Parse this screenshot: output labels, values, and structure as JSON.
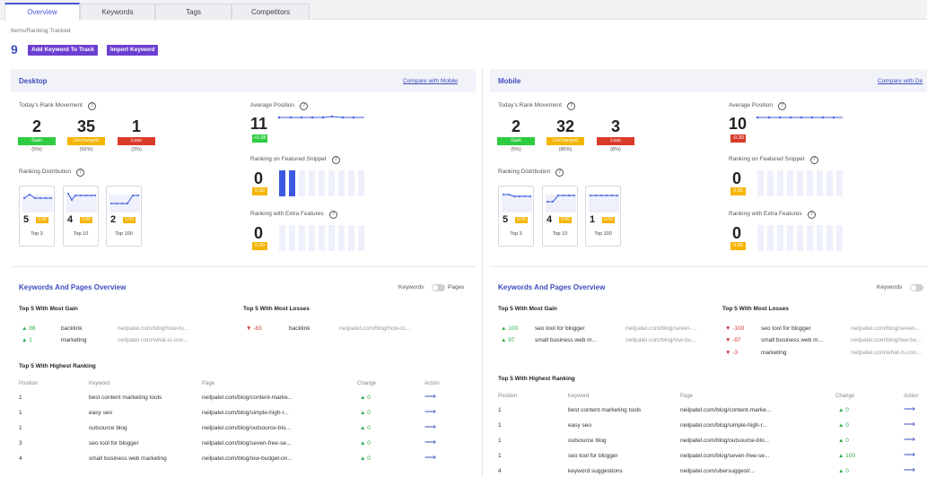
{
  "tabs": [
    "Overview",
    "Keywords",
    "Tags",
    "Competitors"
  ],
  "header": {
    "caption": "Items/Ranking Tracked",
    "count": "9",
    "add_btn": "Add Keyword To Track",
    "import_btn": "Import Keyword"
  },
  "desktop": {
    "title": "Desktop",
    "compare": "Compare with Mobile",
    "rank_movement": "Today's Rank Movement",
    "gain": {
      "value": "2",
      "label": "Gain",
      "pct": "(5%)"
    },
    "unchanged": {
      "value": "35",
      "label": "Unchanged",
      "pct": "(92%)"
    },
    "loss": {
      "value": "1",
      "label": "Loss",
      "pct": "(3%)"
    },
    "dist_label": "Ranking Distribution",
    "cards": [
      {
        "num": "5",
        "chg": "0.00",
        "label": "Top 3"
      },
      {
        "num": "4",
        "chg": "0.00",
        "label": "Top 10"
      },
      {
        "num": "2",
        "chg": "0.00",
        "label": "Top 100"
      }
    ],
    "avg_label": "Average Position",
    "avg_value": "11",
    "avg_change": "+0.38",
    "snippet_label": "Ranking on Featured Snippet",
    "snippet_value": "0",
    "snippet_change": "0.00",
    "extra_label": "Ranking with Extra Features",
    "extra_value": "0",
    "extra_change": "0.00",
    "overview_title": "Keywords And Pages Overview",
    "toggle_left": "Keywords",
    "toggle_right": "Pages",
    "gain_title": "Top 5 With Most Gain",
    "loss_title": "Top 5 With Most Losses",
    "gains": [
      {
        "change": "86",
        "keyword": "backlink",
        "url": "neilpatel.com/blog/how-to..."
      },
      {
        "change": "1",
        "keyword": "marketing",
        "url": "neilpatel.com/what-is-con..."
      }
    ],
    "losses": [
      {
        "change": "-83",
        "keyword": "backlink",
        "url": "neilpatel.com/blog/how-to..."
      }
    ],
    "highest_title": "Top 5 With Highest Ranking",
    "cols": [
      "Position",
      "Keyword",
      "Page",
      "Change",
      "Action"
    ],
    "rows": [
      {
        "pos": "1",
        "kw": "best content marketing tools",
        "page": "neilpatel.com/blog/content-marke...",
        "chg": "0"
      },
      {
        "pos": "1",
        "kw": "easy seo",
        "page": "neilpatel.com/blog/simple-high-r...",
        "chg": "0"
      },
      {
        "pos": "1",
        "kw": "outsource blog",
        "page": "neilpatel.com/blog/outsource-blo...",
        "chg": "0"
      },
      {
        "pos": "3",
        "kw": "seo tool for blogger",
        "page": "neilpatel.com/blog/seven-free-se...",
        "chg": "0"
      },
      {
        "pos": "4",
        "kw": "small business web marketing",
        "page": "neilpatel.com/blog/low-budget-on...",
        "chg": "0"
      }
    ]
  },
  "mobile": {
    "title": "Mobile",
    "compare": "Compare with De",
    "rank_movement": "Today's Rank Movement",
    "gain": {
      "value": "2",
      "label": "Gain",
      "pct": "(5%)"
    },
    "unchanged": {
      "value": "32",
      "label": "Unchanged",
      "pct": "(86%)"
    },
    "loss": {
      "value": "3",
      "label": "Loss",
      "pct": "(8%)"
    },
    "dist_label": "Ranking Distribution",
    "cards": [
      {
        "num": "5",
        "chg": "0.00",
        "label": "Top 3"
      },
      {
        "num": "4",
        "chg": "0.00",
        "label": "Top 10"
      },
      {
        "num": "1",
        "chg": "0.00",
        "label": "Top 100"
      }
    ],
    "avg_label": "Average Position",
    "avg_value": "10",
    "avg_change": "-0.30",
    "snippet_label": "Ranking on Featured Snippet",
    "snippet_value": "0",
    "snippet_change": "0.00",
    "extra_label": "Ranking with Extra Features",
    "extra_value": "0",
    "extra_change": "0.00",
    "overview_title": "Keywords And Pages Overview",
    "toggle_left": "Keywords",
    "gain_title": "Top 5 With Most Gain",
    "loss_title": "Top 5 With Most Losses",
    "gains": [
      {
        "change": "100",
        "keyword": "seo tool for blogger",
        "url": "neilpatel.com/blog/seven-..."
      },
      {
        "change": "97",
        "keyword": "small business web m...",
        "url": "neilpatel.com/blog/low-bu..."
      }
    ],
    "losses": [
      {
        "change": "-100",
        "keyword": "seo tool for blogger",
        "url": "neilpatel.com/blog/seven-..."
      },
      {
        "change": "-97",
        "keyword": "small business web m...",
        "url": "neilpatel.com/blog/low-bu..."
      },
      {
        "change": "-3",
        "keyword": "marketing",
        "url": "neilpatel.com/what-is-con..."
      }
    ],
    "highest_title": "Top 5 With Highest Ranking",
    "cols": [
      "Position",
      "Keyword",
      "Page",
      "Change",
      "Action"
    ],
    "rows": [
      {
        "pos": "1",
        "kw": "best content marketing tools",
        "page": "neilpatel.com/blog/content-marke...",
        "chg": "0"
      },
      {
        "pos": "1",
        "kw": "easy seo",
        "page": "neilpatel.com/blog/simple-high-r...",
        "chg": "0"
      },
      {
        "pos": "1",
        "kw": "outsource blog",
        "page": "neilpatel.com/blog/outsource-blo...",
        "chg": "0"
      },
      {
        "pos": "1",
        "kw": "seo tool for blogger",
        "page": "neilpatel.com/blog/seven-free-se...",
        "chg": "100"
      },
      {
        "pos": "4",
        "kw": "keyword suggestions",
        "page": "neilpatel.com/ubersuggest/...",
        "chg": "0"
      }
    ]
  },
  "colors": {
    "accent": "#3d4dbf",
    "button": "#6c3fd1",
    "gain": "#2ecc40",
    "unchanged": "#f5b400",
    "loss": "#d93b2b"
  },
  "icons": {
    "up": "triangle-up-icon",
    "down": "triangle-down-icon",
    "action": "arrow-right-icon",
    "help": "question-circle-icon"
  }
}
